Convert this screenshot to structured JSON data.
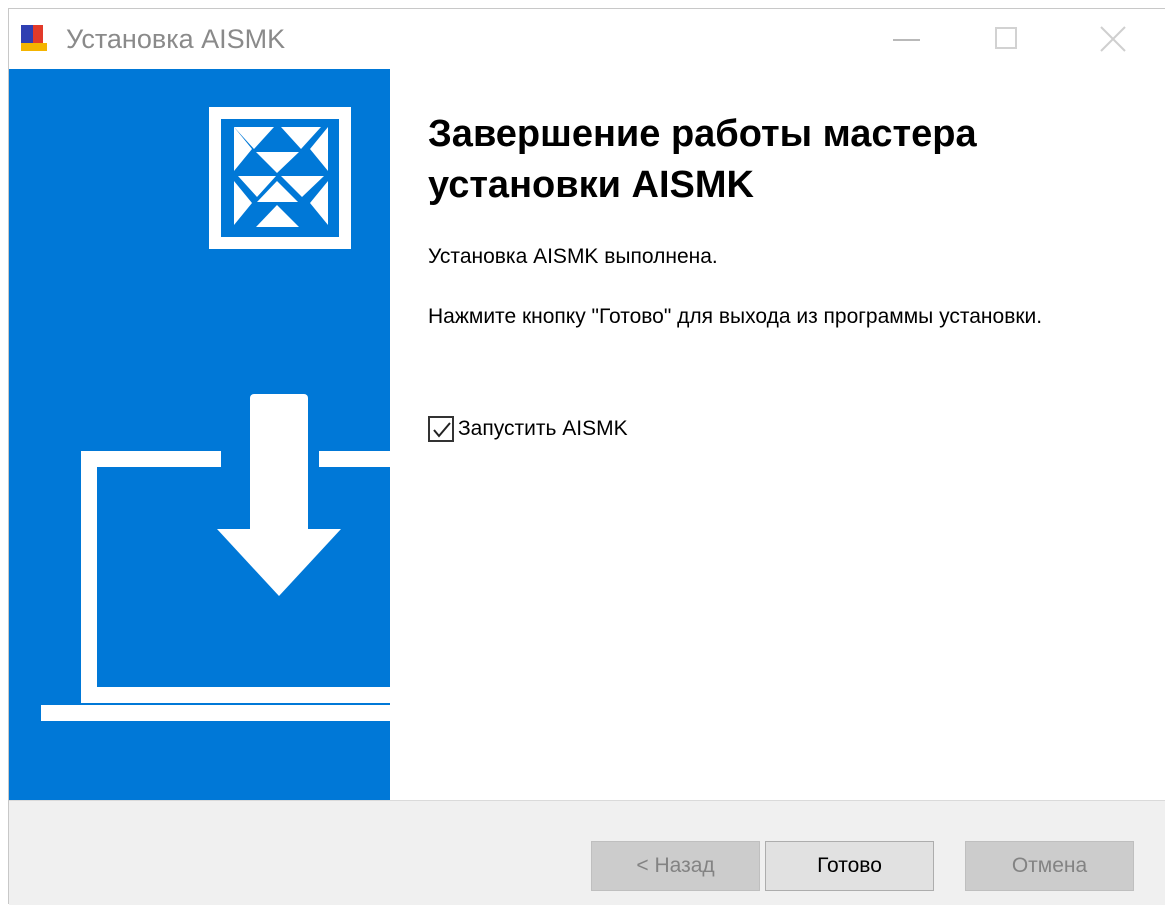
{
  "window": {
    "title": "Установка AISMK"
  },
  "icons": {
    "app": "aismk-installer-icon",
    "minimize": "minimize-icon",
    "maximize": "maximize-icon",
    "close": "close-icon",
    "logo": "aismk-logo-icon",
    "illustration": "laptop-download-icon",
    "checkmark": "checkmark-icon"
  },
  "content": {
    "heading": "Завершение работы мастера установки AISMK",
    "status_text": "Установка AISMK выполнена.",
    "instruction_text": "Нажмите кнопку \"Готово\" для выхода из программы установки.",
    "launch_checkbox": {
      "label": "Запустить AISMK",
      "checked": true
    }
  },
  "footer": {
    "back_label": "< Назад",
    "finish_label": "Готово",
    "cancel_label": "Отмена"
  },
  "colors": {
    "accent": "#0078d7",
    "footer_bg": "#f0f0f0",
    "disabled_text": "#838383"
  }
}
